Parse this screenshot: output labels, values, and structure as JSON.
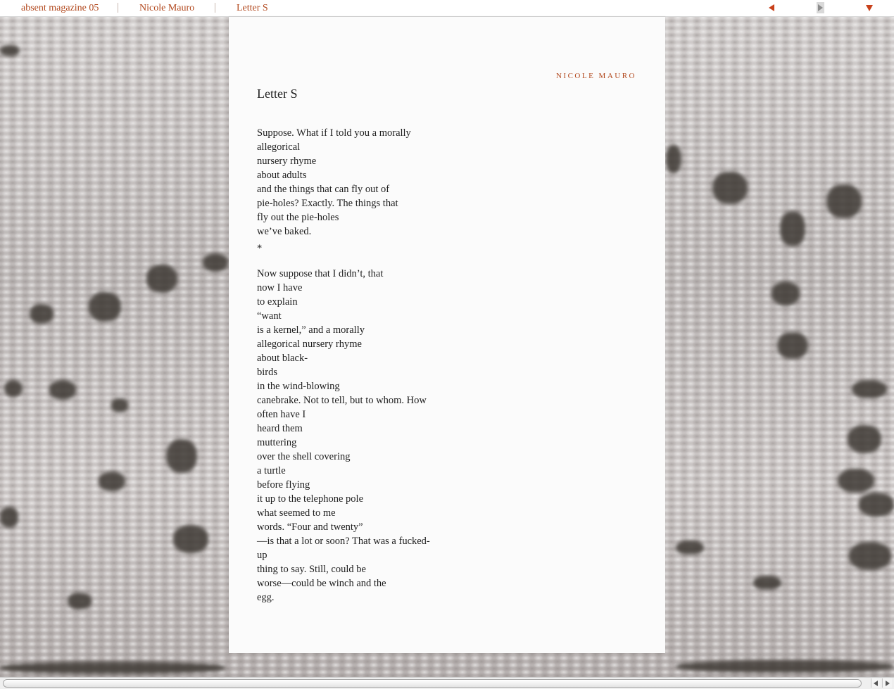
{
  "breadcrumb": [
    "absent magazine 05",
    "Nicole Mauro",
    "Letter S"
  ],
  "nav": {
    "prev_icon": "triangle-left-icon",
    "next_icon": "triangle-right-icon",
    "menu_icon": "triangle-down-icon"
  },
  "colors": {
    "accent": "#b2481d",
    "page": "#fbfbfb",
    "text": "#1e1e1e"
  },
  "article": {
    "author": "NICOLE MAURO",
    "title": "Letter S",
    "stanza1": [
      "Suppose. What if I told you a morally",
      "allegorical",
      "nursery rhyme",
      "about adults",
      "and the things that can fly out of",
      "pie-holes? Exactly. The things that",
      "fly out the pie-holes",
      "we’ve baked."
    ],
    "divider": "*",
    "stanza2": [
      "Now suppose that I didn’t, that",
      "now I have",
      "to explain",
      "“want",
      "is a kernel,” and a morally",
      "allegorical nursery rhyme",
      "about black-",
      "birds",
      "in the wind-blowing",
      "canebrake. Not to tell, but to whom. How",
      "often have I",
      "heard them",
      "muttering",
      "over the shell covering",
      "a turtle",
      "before flying",
      "it up to the telephone pole",
      "what seemed to me",
      "words. “Four and twenty”",
      "—is that a lot or soon? That was a fucked-",
      "up",
      "thing to say. Still, could be",
      "worse—could be winch and the",
      "egg."
    ]
  }
}
